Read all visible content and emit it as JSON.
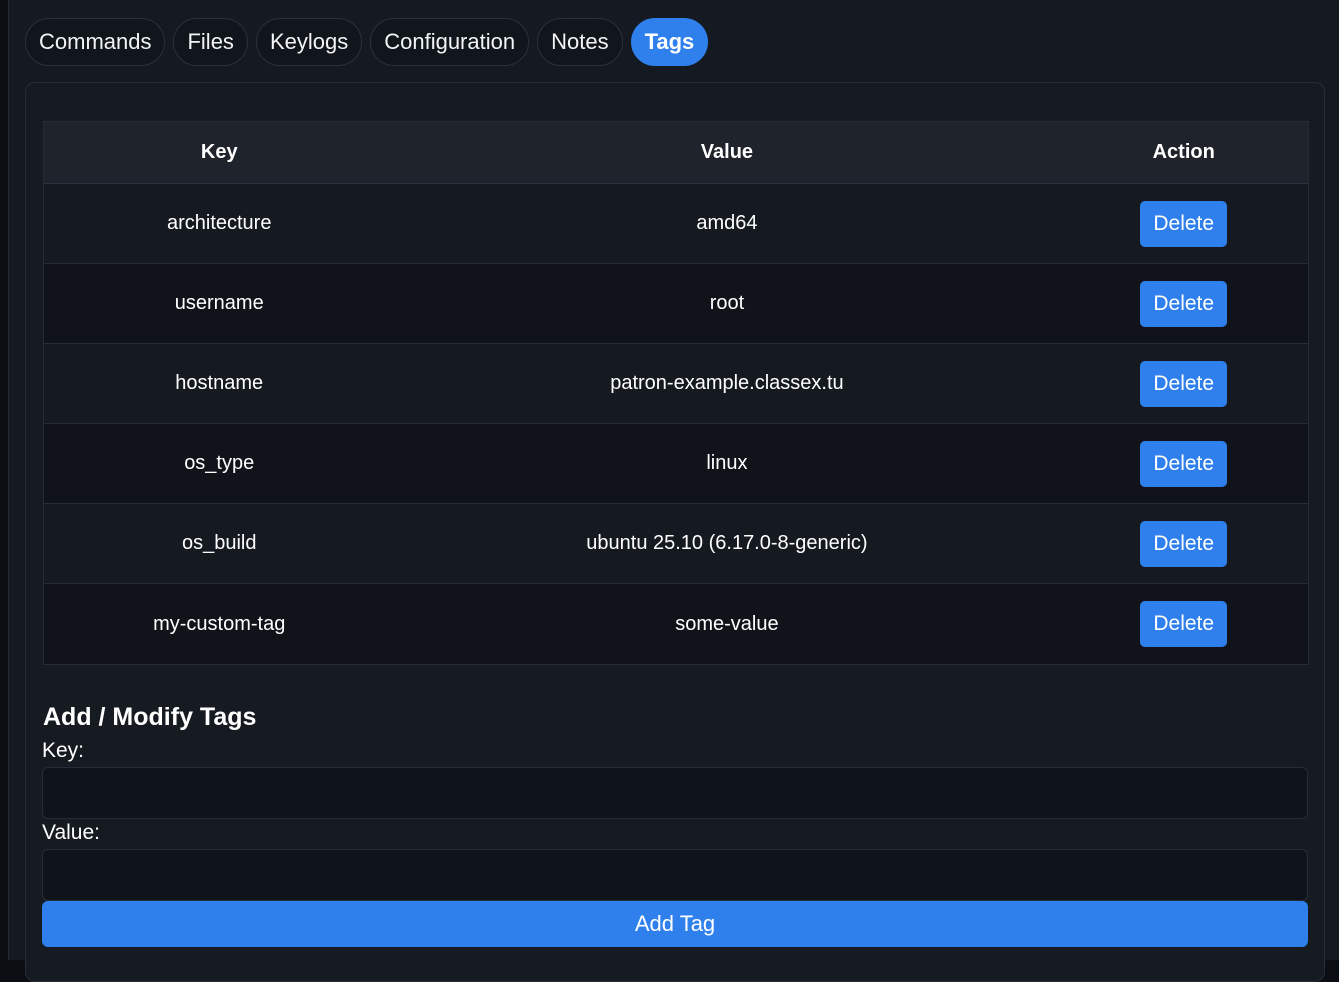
{
  "tabs": [
    {
      "label": "Commands",
      "active": false
    },
    {
      "label": "Files",
      "active": false
    },
    {
      "label": "Keylogs",
      "active": false
    },
    {
      "label": "Configuration",
      "active": false
    },
    {
      "label": "Notes",
      "active": false
    },
    {
      "label": "Tags",
      "active": true
    }
  ],
  "table": {
    "headers": {
      "key": "Key",
      "value": "Value",
      "action": "Action"
    },
    "rows": [
      {
        "key": "architecture",
        "value": "amd64",
        "action": "Delete"
      },
      {
        "key": "username",
        "value": "root",
        "action": "Delete"
      },
      {
        "key": "hostname",
        "value": "patron-example.classex.tu",
        "action": "Delete"
      },
      {
        "key": "os_type",
        "value": "linux",
        "action": "Delete"
      },
      {
        "key": "os_build",
        "value": "ubuntu 25.10 (6.17.0-8-generic)",
        "action": "Delete"
      },
      {
        "key": "my-custom-tag",
        "value": "some-value",
        "action": "Delete"
      }
    ]
  },
  "form": {
    "title": "Add / Modify Tags",
    "key_label": "Key:",
    "key_value": "",
    "value_label": "Value:",
    "value_value": "",
    "submit_label": "Add Tag"
  },
  "colors": {
    "accent": "#2f80ed",
    "background": "#151a22"
  }
}
